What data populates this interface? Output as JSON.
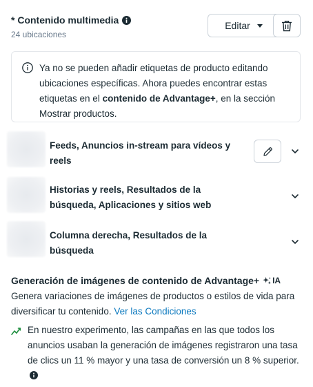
{
  "section": {
    "title": "* Contenido multimedia",
    "locations_count": "24 ubicaciones",
    "edit_label": "Editar"
  },
  "notice": {
    "text_before": "Ya no se pueden añadir etiquetas de producto editando ubicaciones específicas. Ahora puedes encontrar estas etiquetas en el ",
    "text_bold": "contenido de Advantage+",
    "text_after": ", en la sección Mostrar productos."
  },
  "placements": [
    {
      "label": "Feeds, Anuncios in-stream para vídeos y reels"
    },
    {
      "label": "Historias y reels, Resultados de la búsqueda, Aplicaciones y sitios web"
    },
    {
      "label": "Columna derecha, Resultados de la búsqueda"
    }
  ],
  "generation": {
    "title": "Generación de imágenes de contenido de Advantage+",
    "ai_label": "IA",
    "description": "Genera variaciones de imágenes de productos o estilos de vida para diversificar tu contenido.",
    "link_text": "Ver las Condiciones",
    "experiment_text": "En nuestro experimento, las campañas en las que todos los anuncios usaban la generación de imágenes registraron una tasa de clics un 11 % mayor y una tasa de conversión un 8 % superior."
  },
  "colors": {
    "text": "#1c2b33",
    "secondary": "#67788a",
    "link": "#0a78be",
    "border": "#cbd2d9",
    "success": "#1e8e3e"
  },
  "icons": [
    "info-icon",
    "chevron-down-icon",
    "trash-icon",
    "pencil-icon",
    "sparkle-icon",
    "trend-icon"
  ]
}
